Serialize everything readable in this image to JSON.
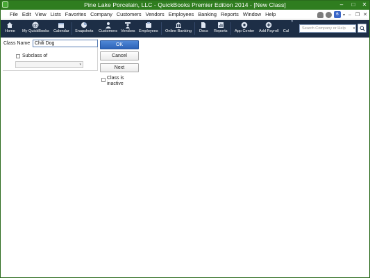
{
  "window": {
    "title": "Pine Lake Porcelain, LLC  - QuickBooks Premier Edition 2014 - [New Class]",
    "minimize": "–",
    "maximize": "□",
    "close": "✕"
  },
  "menubar": {
    "items": [
      "File",
      "Edit",
      "View",
      "Lists",
      "Favorites",
      "Company",
      "Customers",
      "Vendors",
      "Employees",
      "Banking",
      "Reports",
      "Window",
      "Help"
    ],
    "badge": "6",
    "mdi_minimize": "–",
    "mdi_restore": "❐",
    "mdi_close": "✕"
  },
  "toolbar": {
    "items": [
      {
        "label": "Home",
        "icon": "home-icon"
      },
      {
        "label": "My QuickBooks",
        "icon": "my-quickbooks-icon"
      },
      {
        "label": "Calendar",
        "icon": "calendar-icon"
      },
      {
        "label": "Snapshots",
        "icon": "snapshots-icon"
      },
      {
        "label": "Customers",
        "icon": "customers-icon"
      },
      {
        "label": "Vendors",
        "icon": "vendors-icon"
      },
      {
        "label": "Employees",
        "icon": "employees-icon"
      },
      {
        "label": "Online Banking",
        "icon": "online-banking-icon"
      },
      {
        "label": "Docs",
        "icon": "docs-icon"
      },
      {
        "label": "Reports",
        "icon": "reports-icon"
      },
      {
        "label": "App Center",
        "icon": "app-center-icon"
      },
      {
        "label": "Add Payroll",
        "icon": "add-payroll-icon"
      },
      {
        "label": "Cal",
        "icon": ""
      }
    ],
    "search_placeholder": "Search Company or Help"
  },
  "form": {
    "class_name_label": "Class Name",
    "class_name_value": "Chili Dog",
    "subclass_label": "Subclass of",
    "subclass_checked": false,
    "subclass_value": "",
    "inactive_label": "Class is inactive",
    "inactive_checked": false,
    "ok_label": "OK",
    "cancel_label": "Cancel",
    "next_label": "Next"
  },
  "colors": {
    "titlebar": "#2f7d1f",
    "toolbar": "#1d2e46",
    "ok_button": "#2d64b8"
  }
}
